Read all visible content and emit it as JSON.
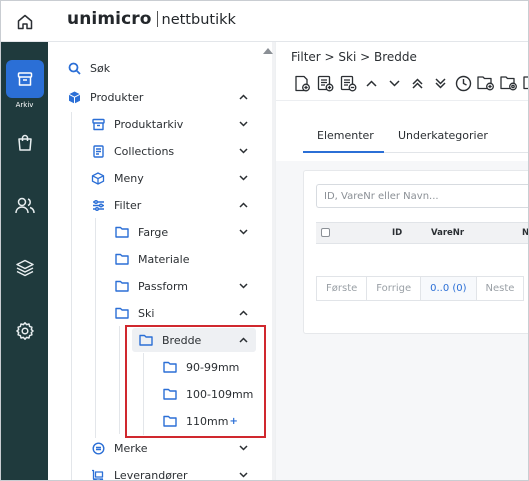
{
  "app": {
    "logo_main": "unimicro",
    "logo_sub": "nettbutikk"
  },
  "rail": {
    "items": [
      {
        "icon": "archive-icon",
        "label": "Arkiv",
        "active": true
      },
      {
        "icon": "shopping-bag-icon",
        "label": ""
      },
      {
        "icon": "users-icon",
        "label": ""
      },
      {
        "icon": "layers-icon",
        "label": ""
      },
      {
        "icon": "gear-icon",
        "label": ""
      }
    ]
  },
  "nav": {
    "search": "Søk",
    "produkter": "Produkter",
    "produktarkiv": "Produktarkiv",
    "collections": "Collections",
    "meny": "Meny",
    "filter": "Filter",
    "farge": "Farge",
    "materiale": "Materiale",
    "passform": "Passform",
    "ski": "Ski",
    "bredde": "Bredde",
    "b1": "90-99mm",
    "b2": "100-109mm",
    "b3": "110mm",
    "b3_plus": "+",
    "merke": "Merke",
    "leverandorer": "Leverandører"
  },
  "main": {
    "breadcrumb": "Filter > Ski > Bredde",
    "tabs": [
      "Elementer",
      "Underkategorier"
    ],
    "active_tab": 0,
    "search_placeholder": "ID, VareNr eller Navn...",
    "columns": [
      "ID",
      "VareNr",
      "Na"
    ],
    "pager": [
      "Første",
      "Forrige",
      "0..0 (0)",
      "Neste"
    ]
  },
  "colors": {
    "rail_bg": "#1f3a3d",
    "accent": "#2b6fd6",
    "highlight": "#d0282e"
  }
}
